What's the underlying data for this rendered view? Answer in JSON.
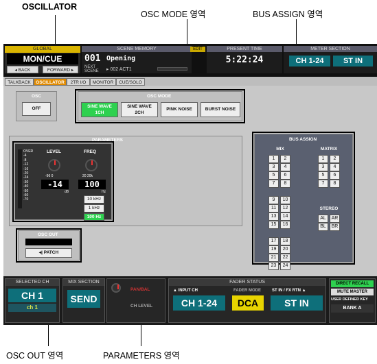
{
  "annotations": {
    "oscillator": "OSCILLATOR",
    "osc_mode_area": "OSC MODE 영역",
    "bus_assign_area": "BUS ASSIGN 영역",
    "osc_out_area": "OSC OUT 영역",
    "parameters_area": "PARAMETERS 영역"
  },
  "global": {
    "label": "GLOBAL",
    "mode": "MON/CUE",
    "back": "◂ BACK",
    "forward": "FORWARD ▸"
  },
  "scene": {
    "header": "SCENE MEMORY",
    "number": "001",
    "title": "Opening",
    "next_label": "NEXT SCENE",
    "next": "▸ 002 ACT1",
    "edit": "EDIT"
  },
  "present_time": {
    "header": "PRESENT TIME",
    "value": "5:22:24"
  },
  "meter_section": {
    "header": "METER SECTION",
    "a": "CH 1-24",
    "b": "ST IN"
  },
  "tabs": [
    "TALKBACK",
    "OSCILLATOR",
    "2TR I/O",
    "MONITOR",
    "CUE/SOLO"
  ],
  "osc": {
    "title": "OSC",
    "off": "OFF"
  },
  "osc_mode": {
    "title": "OSC MODE",
    "sine1_line1": "SINE WAVE",
    "sine1_line2": "1CH",
    "sine2_line1": "SINE WAVE",
    "sine2_line2": "2CH",
    "pink": "PINK NOISE",
    "burst": "BURST NOISE"
  },
  "parameters": {
    "title": "PARAMETERS",
    "meter_scale": [
      "OVER",
      "-4",
      "-8",
      "-12",
      "-16",
      "-20",
      "-24",
      "-30",
      "-40",
      "-50",
      "-60",
      "-70"
    ],
    "level_label": "LEVEL",
    "level_range": "-96  0",
    "level_value": "-14",
    "level_unit": "dB",
    "freq_label": "FREQ",
    "freq_range": "20  20k",
    "freq_value": "100",
    "freq_unit": "Hz",
    "freq_buttons": [
      "10 kHz",
      "1 kHz",
      "100 Hz"
    ]
  },
  "osc_out": {
    "title": "OSC OUT",
    "patch": "◂| PATCH"
  },
  "bus_assign": {
    "title": "BUS ASSIGN",
    "mix_label": "MIX",
    "matrix_label": "MATRIX",
    "stereo_label": "STEREO",
    "mix": [
      "1",
      "2",
      "3",
      "4",
      "5",
      "6",
      "7",
      "8",
      "9",
      "10",
      "11",
      "12",
      "13",
      "14",
      "15",
      "16",
      "17",
      "18",
      "19",
      "20",
      "21",
      "22",
      "23",
      "24"
    ],
    "matrix": [
      "1",
      "2",
      "3",
      "4",
      "5",
      "6",
      "7",
      "8"
    ],
    "stereo": [
      "AL",
      "AR",
      "BL",
      "BR"
    ]
  },
  "bottom": {
    "selected_ch_header": "SELECTED CH",
    "selected_ch": "CH 1",
    "selected_ch_sub": "ch 1",
    "mix_section_header": "MIX SECTION",
    "send": "SEND",
    "pan_bal": "PAN/BAL",
    "ch_level": "CH LEVEL",
    "fader_status_header": "FADER STATUS",
    "input_ch_label": "▲ INPUT CH",
    "input_ch": "CH 1-24",
    "fader_mode": "FADER MODE",
    "dca": "DCA",
    "stin_label": "ST IN / FX RTN ▲",
    "stin": "ST IN",
    "direct_recall": "DIRECT RECALL",
    "mute_master": "MUTE MASTER",
    "user_defined": "USER DEFINED KEY",
    "bank": "BANK A"
  }
}
